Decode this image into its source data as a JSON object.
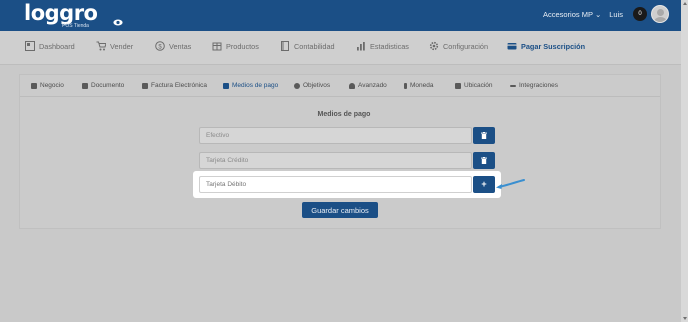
{
  "header": {
    "logo": "loggro",
    "logo_sub": "POS Tienda",
    "store": "Accesorios MP",
    "store_caret": "⌄",
    "user": "Luis",
    "notifications": "0"
  },
  "nav": {
    "items": [
      {
        "label": "Dashboard",
        "icon": "dashboard-icon"
      },
      {
        "label": "Vender",
        "icon": "cart-icon"
      },
      {
        "label": "Ventas",
        "icon": "dollar-circle-icon"
      },
      {
        "label": "Productos",
        "icon": "box-icon"
      },
      {
        "label": "Contabilidad",
        "icon": "book-icon"
      },
      {
        "label": "Estadisticas",
        "icon": "bar-chart-icon"
      },
      {
        "label": "Configuración",
        "icon": "gear-icon"
      },
      {
        "label": "Pagar Suscripción",
        "icon": "credit-card-icon"
      }
    ]
  },
  "subtabs": [
    {
      "label": "Negocio"
    },
    {
      "label": "Documento"
    },
    {
      "label": "Factura Electrónica"
    },
    {
      "label": "Medios de pago"
    },
    {
      "label": "Objetivos"
    },
    {
      "label": "Avanzado"
    },
    {
      "label": "Moneda"
    },
    {
      "label": "Ubicación"
    },
    {
      "label": "Integraciones"
    }
  ],
  "payment": {
    "title": "Medios de pago",
    "methods": [
      {
        "value": "Efectivo"
      },
      {
        "value": "Tarjeta Crédito"
      }
    ],
    "new_placeholder": "Tarjeta Débito",
    "save_label": "Guardar cambios"
  },
  "colors": {
    "brand": "#1b4f86",
    "highlight": "#ffffff",
    "arrow": "#3a8fd0"
  }
}
